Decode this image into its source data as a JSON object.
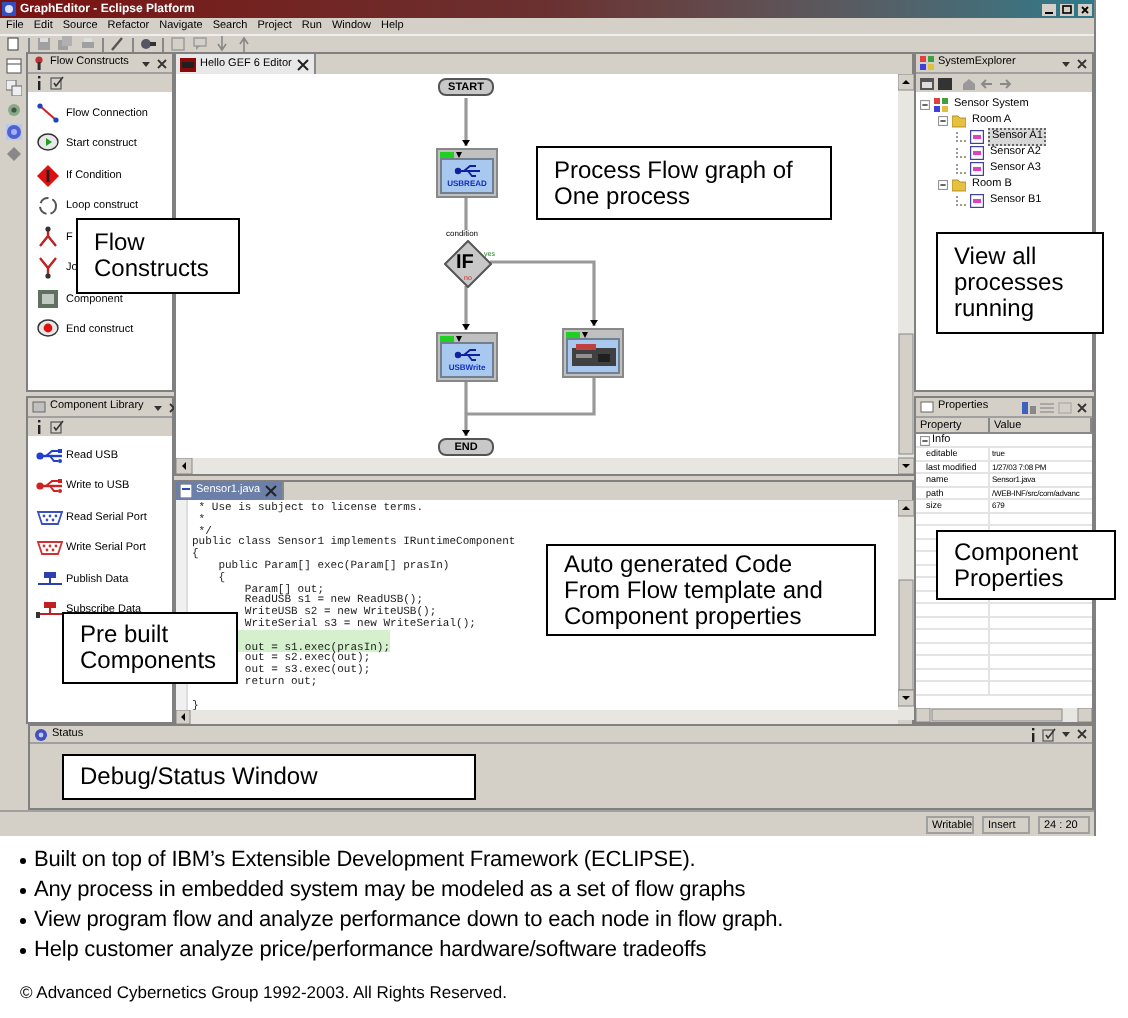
{
  "window": {
    "title": "GraphEditor - Eclipse Platform"
  },
  "menu": [
    "File",
    "Edit",
    "Source",
    "Refactor",
    "Navigate",
    "Search",
    "Project",
    "Run",
    "Window",
    "Help"
  ],
  "flow_constructs": {
    "title": "Flow Constructs",
    "items": [
      {
        "kind": "connection",
        "label": "Flow Connection"
      },
      {
        "kind": "start",
        "label": "Start construct"
      },
      {
        "kind": "if",
        "label": "If Condition"
      },
      {
        "kind": "loop",
        "label": "Loop construct"
      },
      {
        "kind": "fork",
        "label": "F"
      },
      {
        "kind": "join",
        "label": "Jo"
      },
      {
        "kind": "component",
        "label": "Component"
      },
      {
        "kind": "end",
        "label": "End construct"
      }
    ]
  },
  "component_library": {
    "title": "Component Library",
    "items": [
      {
        "kind": "usb",
        "color": "#1f3fd0",
        "label": "Read USB"
      },
      {
        "kind": "usb",
        "color": "#d02020",
        "label": "Write to USB"
      },
      {
        "kind": "serial",
        "color": "#3a4fc0",
        "label": "Read Serial Port"
      },
      {
        "kind": "serial",
        "color": "#d03030",
        "label": "Write Serial Port"
      },
      {
        "kind": "publish",
        "color": "#2a3fb0",
        "label": "Publish Data"
      },
      {
        "kind": "subscribe",
        "color": "#c02020",
        "label": "Subscribe Data"
      }
    ]
  },
  "graph_editor": {
    "tab": "Hello GEF 6 Editor",
    "nodes": [
      {
        "kind": "terminal",
        "label": "START"
      },
      {
        "kind": "usb",
        "label": "USBREAD"
      },
      {
        "kind": "condition",
        "label": "IF",
        "caption": "condition",
        "yes": "yes",
        "no": "no"
      },
      {
        "kind": "usb",
        "label": "USBWrite"
      },
      {
        "kind": "device"
      },
      {
        "kind": "terminal",
        "label": "END"
      }
    ]
  },
  "code_editor": {
    "tab": "Sensor1.java",
    "lines": [
      {
        "text": " * Use is subject to license terms.",
        "current": false,
        "blank_before": false
      },
      {
        "text": " *",
        "current": false,
        "blank_before": false
      },
      {
        "text": " */",
        "current": false,
        "blank_before": false
      },
      {
        "text": "public class Sensor1 implements IRuntimeComponent",
        "current": false,
        "blank_before": false
      },
      {
        "text": "{",
        "current": false,
        "blank_before": false
      },
      {
        "text": "    public Param[] exec(Param[] prasIn)",
        "current": false,
        "blank_before": false
      },
      {
        "text": "    {",
        "current": false,
        "blank_before": false
      },
      {
        "text": "        Param[] out;",
        "current": false,
        "blank_before": false
      },
      {
        "text": "        ReadUSB s1 = new ReadUSB();",
        "current": false,
        "blank_before": false
      },
      {
        "text": "        WriteUSB s2 = new WriteUSB();",
        "current": false,
        "blank_before": false
      },
      {
        "text": "        WriteSerial s3 = new WriteSerial();",
        "current": false,
        "blank_before": false
      },
      {
        "text": "        out = s1.exec(prasIn);",
        "current": true,
        "blank_before": true
      },
      {
        "text": "        out = s2.exec(out);",
        "current": false,
        "blank_before": false
      },
      {
        "text": "        out = s3.exec(out);",
        "current": false,
        "blank_before": false
      },
      {
        "text": "        return out;",
        "current": false,
        "blank_before": false
      },
      {
        "text": "}",
        "current": false,
        "blank_before": true
      }
    ]
  },
  "system_explorer": {
    "title": "SystemExplorer",
    "tree": [
      {
        "label": "Sensor System",
        "kind": "system",
        "expanded": true,
        "selected": false,
        "children": [
          {
            "label": "Room A",
            "kind": "folder",
            "expanded": true,
            "selected": false,
            "children": [
              {
                "label": "Sensor A1",
                "kind": "sensor",
                "selected": true
              },
              {
                "label": "Sensor A2",
                "kind": "sensor",
                "selected": false
              },
              {
                "label": "Sensor A3",
                "kind": "sensor",
                "selected": false
              }
            ]
          },
          {
            "label": "Room B",
            "kind": "folder",
            "expanded": true,
            "selected": false,
            "children": [
              {
                "label": "Sensor B1",
                "kind": "sensor",
                "selected": false
              }
            ]
          }
        ]
      }
    ]
  },
  "properties": {
    "title": "Properties",
    "columns": [
      "Property",
      "Value"
    ],
    "group": "Info",
    "rows": [
      {
        "property": "editable",
        "value": "true"
      },
      {
        "property": "last modified",
        "value": "1/27/03 7:08 PM"
      },
      {
        "property": "name",
        "value": "Sensor1.java"
      },
      {
        "property": "path",
        "value": "/WEB-INF/src/com/advanc"
      },
      {
        "property": "size",
        "value": "679"
      }
    ]
  },
  "status_view": {
    "title": "Status"
  },
  "status_bar": [
    "Writable",
    "Insert",
    "24 : 20"
  ],
  "callouts": [
    {
      "lines": [
        "Flow",
        "Constructs"
      ]
    },
    {
      "lines": [
        "Process Flow graph of",
        "One process"
      ]
    },
    {
      "lines": [
        "View all",
        "processes",
        "running"
      ]
    },
    {
      "lines": [
        "Pre built",
        "Components"
      ]
    },
    {
      "lines": [
        "Auto generated Code",
        "From Flow template and",
        "Component properties"
      ]
    },
    {
      "lines": [
        "Component",
        "Properties"
      ]
    },
    {
      "lines": [
        "Debug/Status Window"
      ]
    }
  ],
  "bullets": [
    "Built on top of IBM’s Extensible Development Framework (ECLIPSE).",
    "Any process in embedded system may be modeled as a set of flow graphs",
    "View program flow and analyze performance down to each node in flow graph.",
    "Help customer analyze price/performance hardware/software tradeoffs"
  ],
  "copyright": "© Advanced Cybernetics Group 1992-2003. All Rights Reserved."
}
